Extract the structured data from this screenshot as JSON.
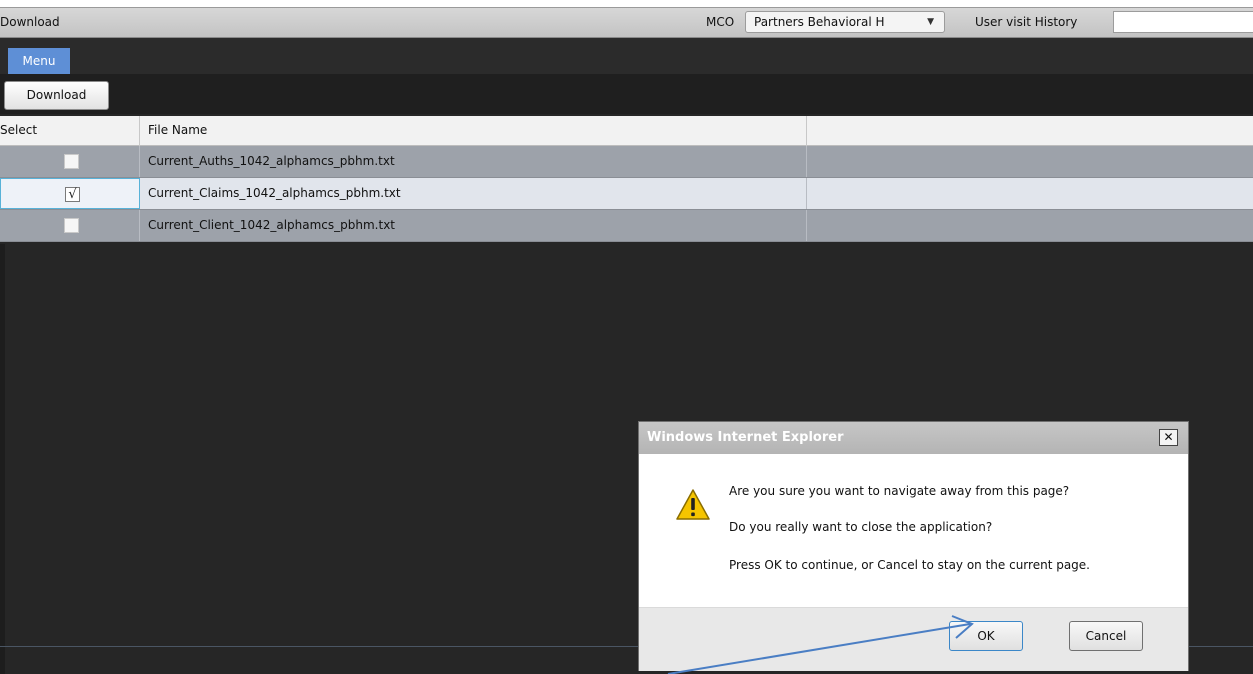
{
  "header": {
    "title": "Download",
    "mco_label": "MCO",
    "mco_selected": "Partners Behavioral H",
    "history_label": "User visit History",
    "history_value": ""
  },
  "menu": {
    "tab_label": "Menu"
  },
  "toolbar": {
    "download_label": "Download"
  },
  "grid": {
    "columns": [
      "Select",
      "File Name"
    ],
    "rows": [
      {
        "file": "Current_Auths_1042_alphamcs_pbhm.txt",
        "checked": false
      },
      {
        "file": "Current_Claims_1042_alphamcs_pbhm.txt",
        "checked": true
      },
      {
        "file": "Current_Client_1042_alphamcs_pbhm.txt",
        "checked": false
      }
    ],
    "check_glyph": "√"
  },
  "dialog": {
    "title": "Windows Internet Explorer",
    "close_glyph": "✕",
    "messages": [
      "Are you sure you want to navigate away from this page?",
      "Do you really want to close the application?",
      "Press OK to continue, or Cancel to stay on the current page."
    ],
    "ok_label": "OK",
    "cancel_label": "Cancel",
    "icon": "warning-icon"
  },
  "colors": {
    "accent": "#5e8fd6",
    "annotation_arrow": "#4a7ec4"
  }
}
